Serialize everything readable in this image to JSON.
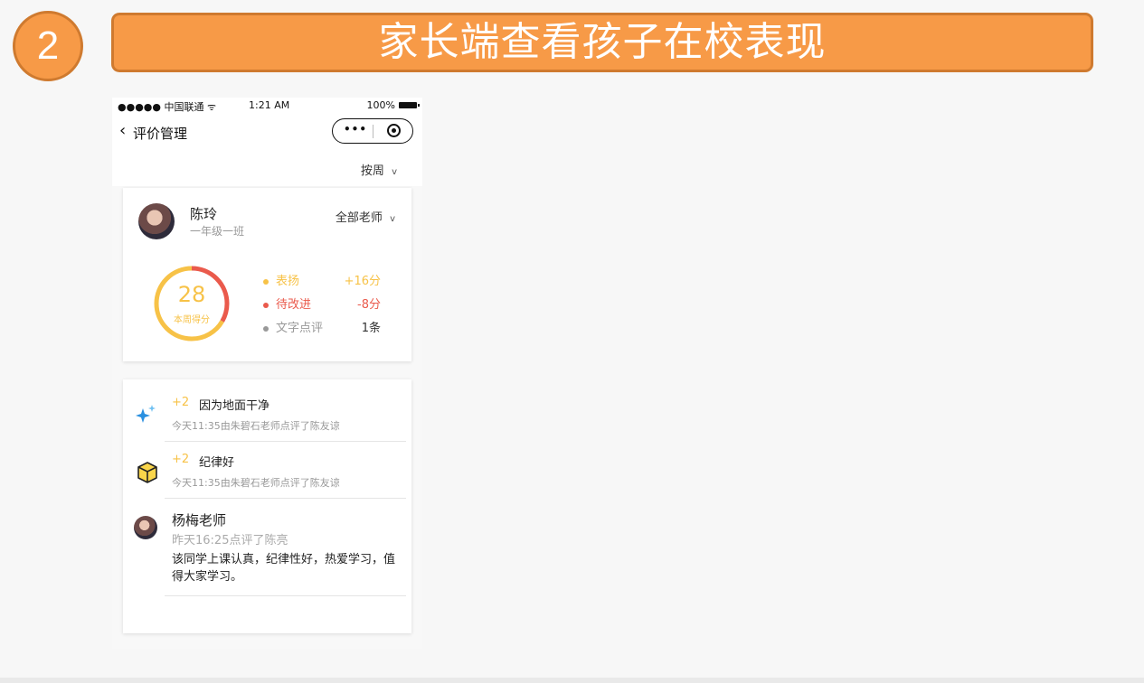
{
  "slide": {
    "step_number": "2",
    "title": "家长端查看孩子在校表现"
  },
  "statusbar": {
    "carrier": "●●●●● 中国联通 ᯤ",
    "time": "1:21 AM",
    "battery": "100%"
  },
  "nav": {
    "back_glyph": "‹",
    "title": "评价管理",
    "more_dots": "•••"
  },
  "filter": {
    "period": "按周",
    "chevron": "v"
  },
  "summary": {
    "student_name": "陈玲",
    "student_class": "一年级一班",
    "teacher_filter": "全部老师",
    "teacher_chevron": "v",
    "score": "28",
    "score_label": "本周得分",
    "score_ring": {
      "praise_fraction": 0.667,
      "improve_fraction": 0.333,
      "praise_color": "#f7c247",
      "improve_color": "#ea5a4c"
    },
    "stats": [
      {
        "label": "表扬",
        "value": "+16分"
      },
      {
        "label": "待改进",
        "value": "-8分"
      },
      {
        "label": "文字点评",
        "value": "1条"
      }
    ]
  },
  "entries": [
    {
      "icon": "sparkle-icon",
      "score": "+2",
      "reason": "因为地面干净",
      "meta": "今天11:35由朱碧石老师点评了陈友谅"
    },
    {
      "icon": "box-icon",
      "score": "+2",
      "reason": "纪律好",
      "meta": "今天11:35由朱碧石老师点评了陈友谅"
    }
  ],
  "comment": {
    "teacher": "杨梅老师",
    "meta": "昨天16:25点评了陈亮",
    "text": "该同学上课认真，纪律性好，热爱学习，值得大家学习。"
  },
  "colors": {
    "accent_orange": "#f79a47",
    "accent_border": "#cf7a2f",
    "praise": "#f7c247",
    "improve": "#ea5a4c"
  }
}
